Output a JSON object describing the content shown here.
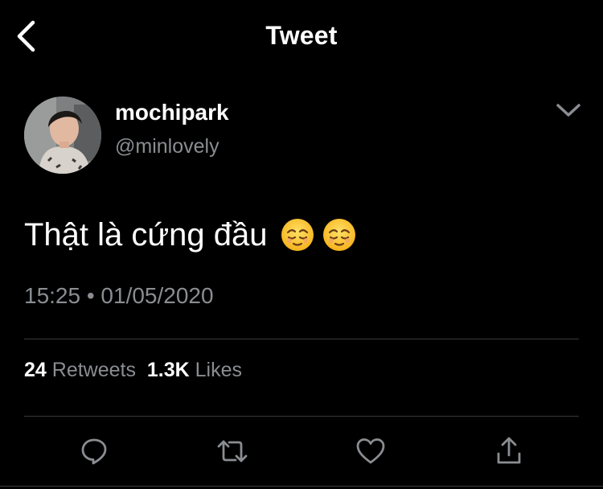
{
  "header": {
    "title": "Tweet"
  },
  "author": {
    "display_name": "mochipark",
    "handle": "@minlovely"
  },
  "tweet": {
    "text": "Thật là cứng đầu",
    "emojis": [
      "relieved-face",
      "relieved-face"
    ],
    "timestamp": "15:25 • 01/05/2020"
  },
  "stats": {
    "retweets_count": "24",
    "retweets_label": "Retweets",
    "likes_count": "1.3K",
    "likes_label": "Likes"
  },
  "actions": {
    "icons": [
      "reply-icon",
      "retweet-icon",
      "like-icon",
      "share-icon"
    ]
  },
  "colors": {
    "background": "#000000",
    "text_primary": "#ffffff",
    "text_secondary": "#8a8d91",
    "divider": "#3a3a3c"
  }
}
